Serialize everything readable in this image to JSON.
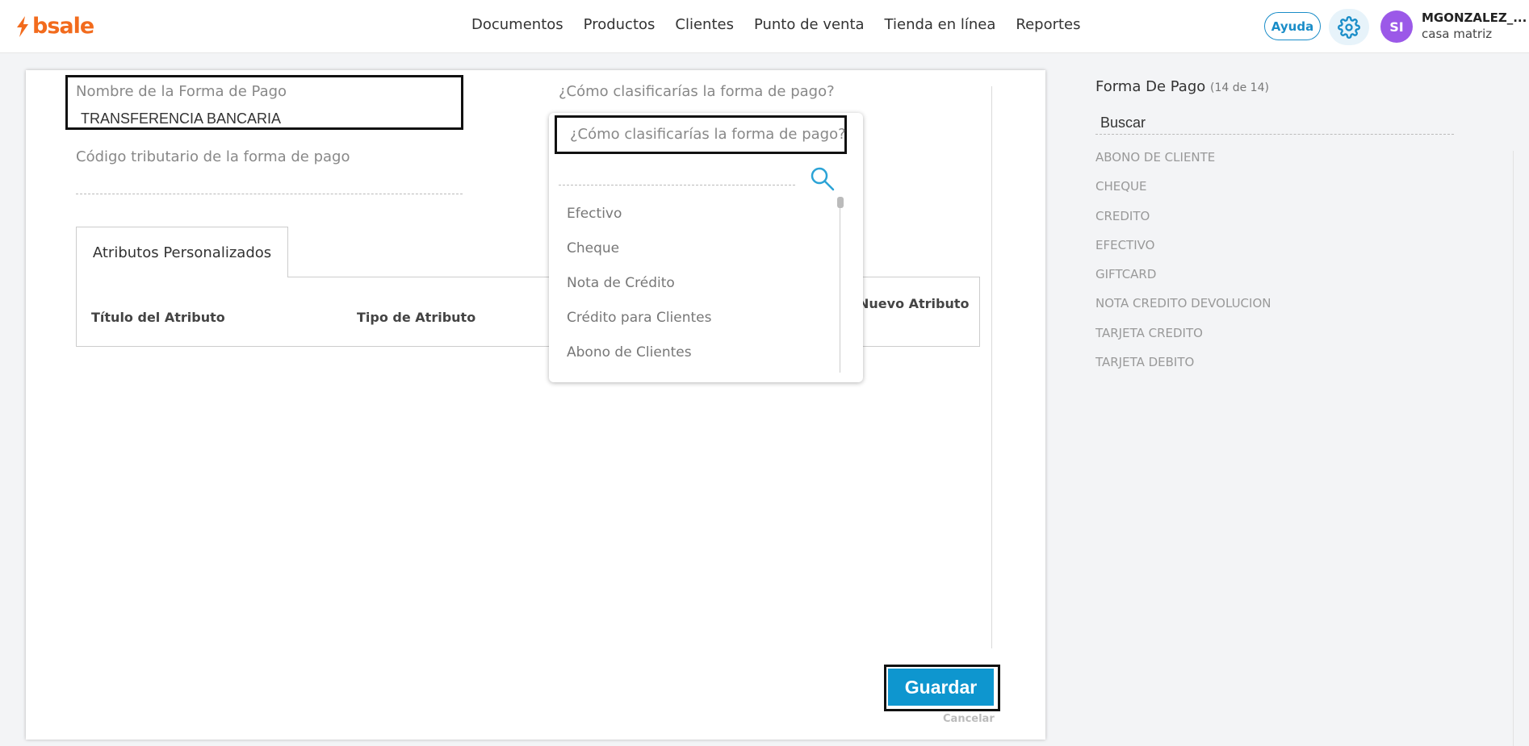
{
  "app": {
    "logo_text": "bsale",
    "brand_color": "#f26b1d",
    "accent_color": "#0e96cf"
  },
  "nav": {
    "items": [
      {
        "label": "Documentos"
      },
      {
        "label": "Productos"
      },
      {
        "label": "Clientes"
      },
      {
        "label": "Punto de venta"
      },
      {
        "label": "Tienda en línea"
      },
      {
        "label": "Reportes"
      }
    ]
  },
  "header": {
    "help_label": "Ayuda",
    "settings_icon": "gear-icon",
    "avatar_initials": "SI",
    "user_name": "MGONZALEZ_...",
    "branch": "casa matriz"
  },
  "form": {
    "name_label": "Nombre de la Forma de Pago",
    "name_value": "TRANSFERENCIA BANCARIA",
    "code_label": "Código tributario de la forma de pago",
    "classify_label": "¿Cómo clasificarías la forma de pago?"
  },
  "attributes": {
    "tab_label": "Atributos Personalizados",
    "col_title": "Título del Atributo",
    "col_type": "Tipo de Atributo",
    "new_attr": "Nuevo Atributo"
  },
  "dropdown": {
    "title": "¿Cómo clasificarías la forma de pago?",
    "search_icon": "search-icon",
    "options": [
      {
        "label": "Efectivo"
      },
      {
        "label": "Cheque"
      },
      {
        "label": "Nota de Crédito"
      },
      {
        "label": "Crédito para Clientes"
      },
      {
        "label": "Abono de Clientes"
      }
    ]
  },
  "actions": {
    "save_label": "Guardar",
    "cancel_label": "Cancelar"
  },
  "sidebar": {
    "title": "Forma De Pago",
    "count": "(14 de 14)",
    "search_placeholder": "Buscar",
    "items": [
      {
        "label": "ABONO DE CLIENTE"
      },
      {
        "label": "CHEQUE"
      },
      {
        "label": "CREDITO"
      },
      {
        "label": "EFECTIVO"
      },
      {
        "label": "GIFTCARD"
      },
      {
        "label": "NOTA CREDITO DEVOLUCION"
      },
      {
        "label": "TARJETA CREDITO"
      },
      {
        "label": "TARJETA DEBITO"
      }
    ]
  }
}
